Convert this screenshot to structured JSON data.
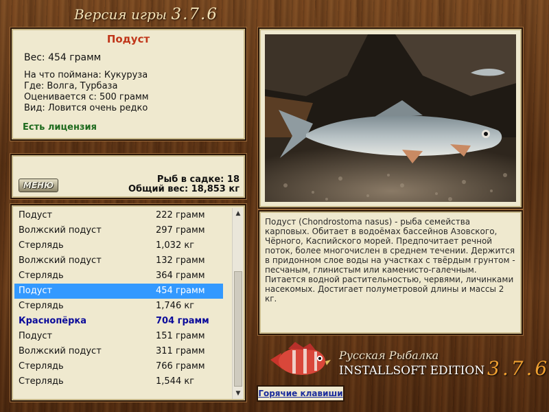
{
  "header": {
    "title": "Версия игры",
    "version": "3.7.6"
  },
  "fish_info": {
    "name": "Подуст",
    "weight": "Вес: 454 грамм",
    "lines": [
      "На что поймана: Кукуруза",
      "Где: Волга, Турбаза",
      "Оценивается с: 500 грамм",
      "Вид: Ловится очень редко"
    ],
    "license": "Есть лицензия"
  },
  "keepnet": {
    "logo_text": "МЕНЮ",
    "count_text": "Рыб в садке: 18",
    "total_text": "Общий вес: 18,853 кг"
  },
  "catch_list": [
    {
      "name": "Подуст",
      "weight": "222 грамм"
    },
    {
      "name": "Волжский подуст",
      "weight": "297 грамм"
    },
    {
      "name": "Стерлядь",
      "weight": "1,032 кг"
    },
    {
      "name": "Волжский подуст",
      "weight": "132 грамм"
    },
    {
      "name": "Стерлядь",
      "weight": "364 грамм"
    },
    {
      "name": "Подуст",
      "weight": "454 грамм"
    },
    {
      "name": "Стерлядь",
      "weight": "1,746 кг"
    },
    {
      "name": "Краснопёрка",
      "weight": "704 грамм"
    },
    {
      "name": "Подуст",
      "weight": "151 грамм"
    },
    {
      "name": "Волжский подуст",
      "weight": "311 грамм"
    },
    {
      "name": "Стерлядь",
      "weight": "766 грамм"
    },
    {
      "name": "Стерлядь",
      "weight": "1,544 кг"
    }
  ],
  "selected_index": 5,
  "highlighted_index": 7,
  "description": "Подуст (Chondrostoma nasus) - рыба семейства карповых. Обитает в водоёмах бассейнов Азовского, Чёрного, Каспийского морей. Предпочитает речной поток, более многочислен в среднем течении. Держится в придонном слое воды на участках с твёрдым грунтом - песчаным, глинистым или каменисто-галечным. Питается водной растительностью, червями, личинками насекомых. Достигает полуметровой длины и массы 2 кг.",
  "branding": {
    "line1": "Русская Рыбалка",
    "line2": "INSTALLSOFT EDITION",
    "version": "3.7.6"
  },
  "hotkeys_label": "Горячие клавиши",
  "colors": {
    "fish_name": "#c0361a",
    "license": "#1d6a1d",
    "selection": "#3399ff",
    "highlight": "#0b0b9a"
  }
}
